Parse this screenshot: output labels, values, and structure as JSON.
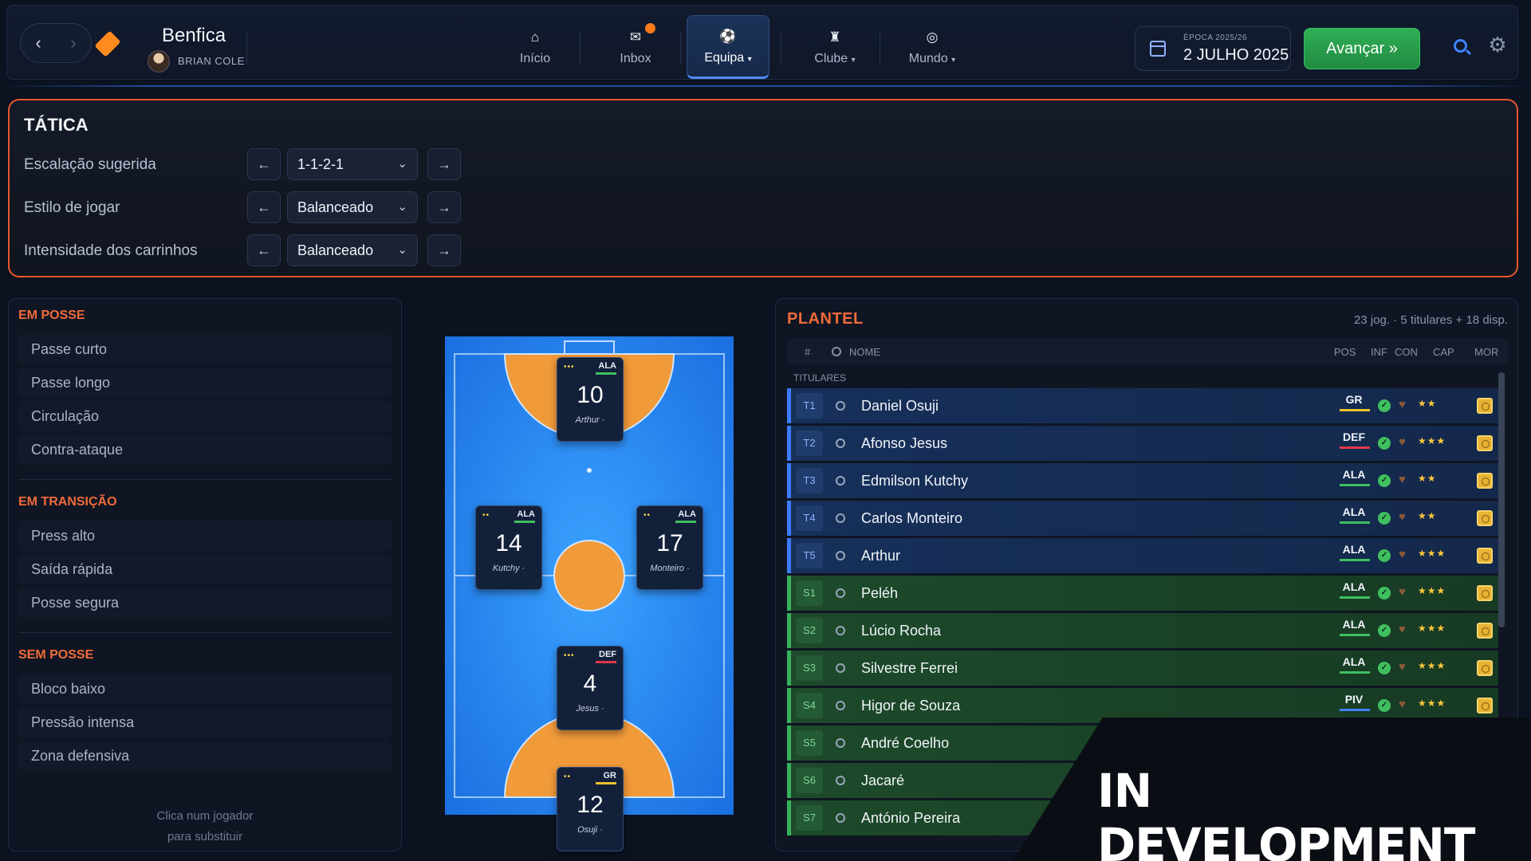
{
  "header": {
    "club_name": "Benfica",
    "manager_name": "BRIAN COLE",
    "menu": [
      {
        "label": "Início",
        "icon": "home-icon"
      },
      {
        "label": "Inbox",
        "icon": "mail-icon"
      },
      {
        "label": "Equipa",
        "icon": "ball-icon",
        "caret": "▾"
      },
      {
        "label": "Clube",
        "icon": "club-icon",
        "caret": "▾"
      },
      {
        "label": "Mundo",
        "icon": "globe-icon",
        "caret": "▾"
      }
    ],
    "season_label": "ÉPOCA 2025/26",
    "date": "2 JULHO 2025",
    "advance_label": "Avançar »"
  },
  "tactics": {
    "title": "TÁTICA",
    "rows": [
      {
        "label": "Escalação sugerida",
        "value": "1-1-2-1"
      },
      {
        "label": "Estilo de jogar",
        "value": "Balanceado"
      },
      {
        "label": "Intensidade dos carrinhos",
        "value": "Balanceado"
      }
    ],
    "prev_glyph": "←",
    "next_glyph": "→"
  },
  "styles": {
    "groups": [
      {
        "title": "EM POSSE",
        "items": [
          "Passe curto",
          "Passe longo",
          "Circulação",
          "Contra-ataque"
        ]
      },
      {
        "title": "EM TRANSIÇÃO",
        "items": [
          "Press alto",
          "Saída rápida",
          "Posse segura"
        ]
      },
      {
        "title": "SEM POSSE",
        "items": [
          "Bloco baixo",
          "Pressão intensa",
          "Zona defensiva"
        ]
      }
    ],
    "hint_line1": "Clica num jogador",
    "hint_line2": "para substituir"
  },
  "pitch": {
    "players": [
      {
        "number": "10",
        "name": "Arthur ·",
        "position": "ALA",
        "stars": "•••",
        "position_color": "#3fbf5f"
      },
      {
        "number": "14",
        "name": "Kutchy ·",
        "position": "ALA",
        "stars": "••",
        "position_color": "#3fbf5f"
      },
      {
        "number": "17",
        "name": "Monteiro ·",
        "position": "ALA",
        "stars": "••",
        "position_color": "#3fbf5f"
      },
      {
        "number": "4",
        "name": "Jesus ·",
        "position": "DEF",
        "stars": "•••",
        "position_color": "#e0384a"
      },
      {
        "number": "12",
        "name": "Osuji ·",
        "position": "GR",
        "stars": "••",
        "position_color": "#f2c12e"
      }
    ]
  },
  "squad": {
    "title": "PLANTEL",
    "summary": "23 jog. · 5 titulares + 18 disp.",
    "columns": [
      "#",
      "NOME",
      "POS",
      "INF",
      "CON",
      "CAP",
      "MOR"
    ],
    "group_label": "TITULARES",
    "rows": [
      {
        "idx": "T1",
        "name": "Daniel Osuji",
        "pos": "GR",
        "cap": "★★",
        "kind": "t",
        "pos_color": "#f2c12e"
      },
      {
        "idx": "T2",
        "name": "Afonso Jesus",
        "pos": "DEF",
        "cap": "★★★",
        "kind": "t",
        "pos_color": "#e0384a"
      },
      {
        "idx": "T3",
        "name": "Edmilson Kutchy",
        "pos": "ALA",
        "cap": "★★",
        "kind": "t",
        "pos_color": "#3fbf5f"
      },
      {
        "idx": "T4",
        "name": "Carlos Monteiro",
        "pos": "ALA",
        "cap": "★★",
        "kind": "t",
        "pos_color": "#3fbf5f"
      },
      {
        "idx": "T5",
        "name": "Arthur",
        "pos": "ALA",
        "cap": "★★★",
        "kind": "t",
        "pos_color": "#3fbf5f"
      },
      {
        "idx": "S1",
        "name": "Peléh",
        "pos": "ALA",
        "cap": "★★★",
        "kind": "s",
        "pos_color": "#3fbf5f"
      },
      {
        "idx": "S2",
        "name": "Lúcio Rocha",
        "pos": "ALA",
        "cap": "★★★",
        "kind": "s",
        "pos_color": "#3fbf5f"
      },
      {
        "idx": "S3",
        "name": "Silvestre Ferrei",
        "pos": "ALA",
        "cap": "★★★",
        "kind": "s",
        "pos_color": "#3fbf5f"
      },
      {
        "idx": "S4",
        "name": "Higor de Souza",
        "pos": "PIV",
        "cap": "★★★",
        "kind": "s",
        "pos_color": "#3f82ff"
      },
      {
        "idx": "S5",
        "name": "André Coelho",
        "pos": "",
        "cap": "",
        "kind": "s",
        "pos_color": "#3fbf5f"
      },
      {
        "idx": "S6",
        "name": "Jacaré",
        "pos": "",
        "cap": "",
        "kind": "s",
        "pos_color": "#3fbf5f"
      },
      {
        "idx": "S7",
        "name": "António Pereira",
        "pos": "",
        "cap": "",
        "kind": "s",
        "pos_color": "#3fbf5f"
      }
    ]
  },
  "watermark": "IN DEVELOPMENT",
  "colors": {
    "accent": "#e8572c",
    "primary": "#3f82ff",
    "advance": "#2fae55"
  }
}
